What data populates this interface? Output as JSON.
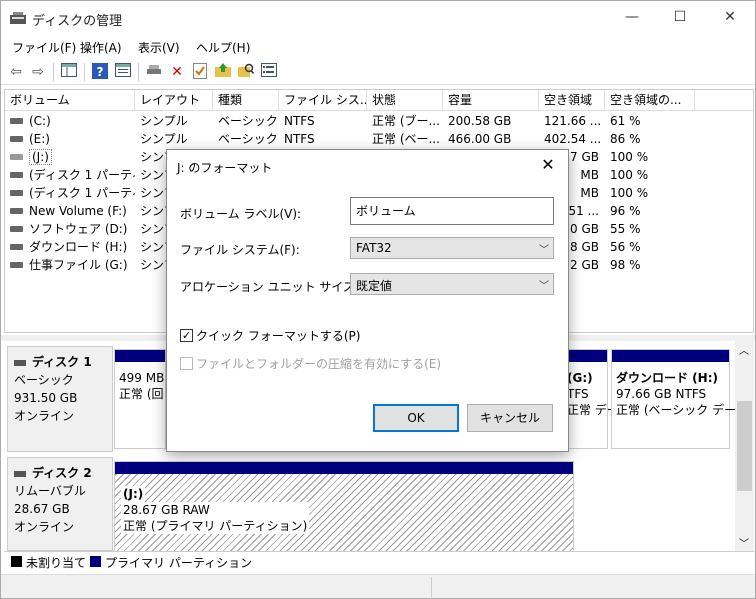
{
  "window": {
    "title": "ディスクの管理",
    "controls": {
      "minimize": "—",
      "maximize": "☐",
      "close": "✕"
    }
  },
  "menu": [
    "ファイル(F)",
    "操作(A)",
    "表示(V)",
    "ヘルプ(H)"
  ],
  "columns": [
    "ボリューム",
    "レイアウト",
    "種類",
    "ファイル シス...",
    "状態",
    "容量",
    "空き領域",
    "空き領域の..."
  ],
  "volumes": [
    {
      "name": "(C:)",
      "layout": "シンプル",
      "type": "ベーシック",
      "fs": "NTFS",
      "status": "正常 (ブー...",
      "capacity": "200.58 GB",
      "free": "121.66 ...",
      "pct": "61 %"
    },
    {
      "name": "(E:)",
      "layout": "シンプル",
      "type": "ベーシック",
      "fs": "NTFS",
      "status": "正常 (ベー...",
      "capacity": "466.00 GB",
      "free": "402.54 ...",
      "pct": "86 %"
    },
    {
      "name": "(J:)",
      "layout": "シンプ",
      "type": "",
      "fs": "",
      "status": "",
      "capacity": "",
      "free": "7 GB",
      "pct": "100 %"
    },
    {
      "name": "(ディスク 1 パーティ...",
      "layout": "シンプ",
      "type": "",
      "fs": "",
      "status": "",
      "capacity": "",
      "free": "MB",
      "pct": "100 %"
    },
    {
      "name": "(ディスク 1 パーティ...",
      "layout": "シンプ",
      "type": "",
      "fs": "",
      "status": "",
      "capacity": "",
      "free": "MB",
      "pct": "100 %"
    },
    {
      "name": "New Volume (F:)",
      "layout": "シンプ",
      "type": "",
      "fs": "",
      "status": "",
      "capacity": "",
      "free": "51 ...",
      "pct": "96 %"
    },
    {
      "name": "ソフトウェア (D:)",
      "layout": "シンプ",
      "type": "",
      "fs": "",
      "status": "",
      "capacity": "",
      "free": "0 GB",
      "pct": "55 %"
    },
    {
      "name": "ダウンロード (H:)",
      "layout": "シンプ",
      "type": "",
      "fs": "",
      "status": "",
      "capacity": "",
      "free": "8 GB",
      "pct": "56 %"
    },
    {
      "name": "仕事ファイル (G:)",
      "layout": "シンプ",
      "type": "",
      "fs": "",
      "status": "",
      "capacity": "",
      "free": "2 GB",
      "pct": "98 %"
    }
  ],
  "disks": [
    {
      "name": "ディスク 1",
      "type": "ベーシック",
      "size": "931.50 GB",
      "state": "オンライン",
      "partitions": [
        {
          "lines": [
            "499 MB",
            "正常 (回"
          ]
        },
        {
          "lines": [
            "(G:)",
            "TFS",
            "正常 デー"
          ]
        },
        {
          "lines": [
            "ダウンロード  (H:)",
            "97.66 GB NTFS",
            "正常 (ベーシック デー"
          ]
        }
      ]
    },
    {
      "name": "ディスク 2",
      "type": "リムーバブル",
      "size": "28.67 GB",
      "state": "オンライン",
      "partitions": [
        {
          "lines": [
            "(J:)",
            "28.67 GB RAW",
            "正常 (プライマリ パーティション)"
          ]
        }
      ]
    }
  ],
  "legend": [
    {
      "label": "未割り当て",
      "color": "#000000"
    },
    {
      "label": "プライマリ パーティション",
      "color": "#00007f"
    }
  ],
  "dialog": {
    "title": "J: のフォーマット",
    "close": "✕",
    "volume_label_label": "ボリューム ラベル(V):",
    "volume_label_value": "ボリューム",
    "fs_label": "ファイル システム(F):",
    "fs_value": "FAT32",
    "alloc_label": "アロケーション ユニット サイズ(A):",
    "alloc_value": "既定値",
    "quick_format": "クイック フォーマットする(P)",
    "quick_format_checked": "✓",
    "compress": "ファイルとフォルダーの圧縮を有効にする(E)",
    "ok": "OK",
    "cancel": "キャンセル"
  },
  "colors": {
    "primary_partition": "#00007f",
    "accent": "#0078d7"
  }
}
